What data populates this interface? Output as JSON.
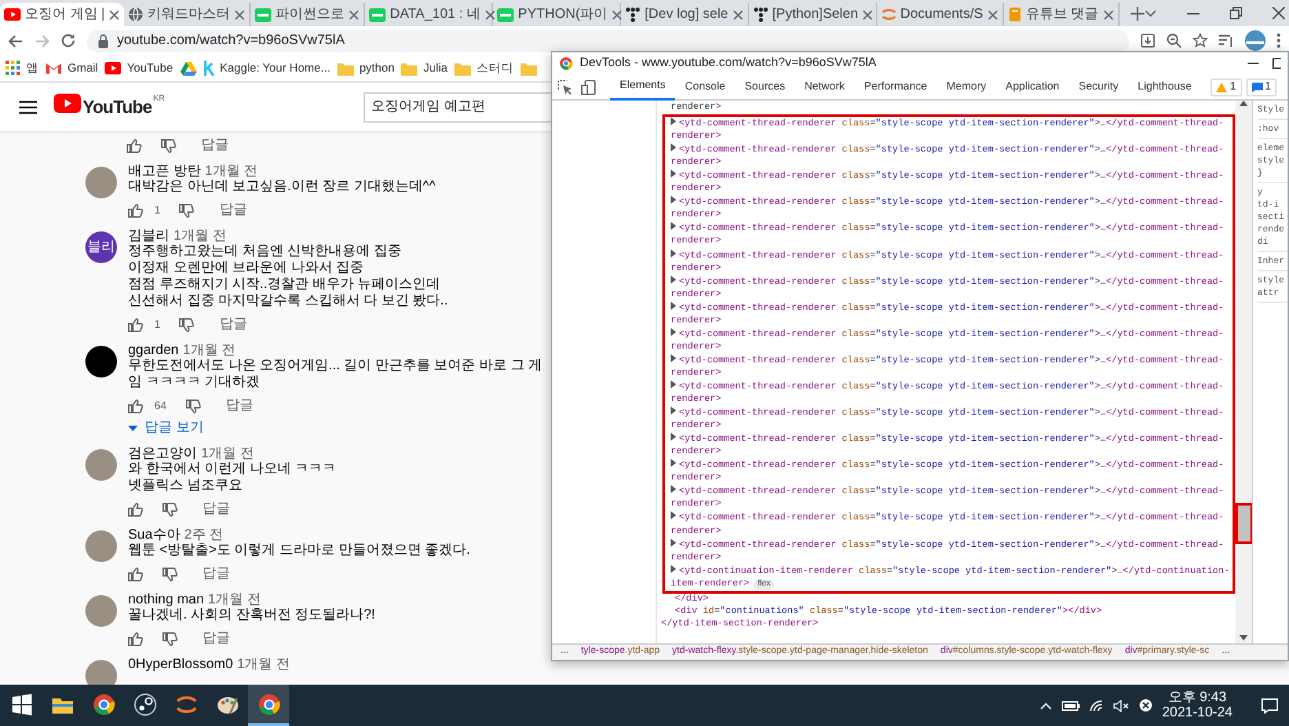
{
  "browser": {
    "tabs": [
      {
        "title": "오징어 게임 |",
        "selected": true
      },
      {
        "title": "키워드마스터",
        "selected": false
      },
      {
        "title": "파이썬으로",
        "selected": false
      },
      {
        "title": "DATA_101 : 네",
        "selected": false
      },
      {
        "title": "PYTHON(파이",
        "selected": false
      },
      {
        "title": "[Dev log] sele",
        "selected": false
      },
      {
        "title": "[Python]Selen",
        "selected": false
      },
      {
        "title": "Documents/S",
        "selected": false
      },
      {
        "title": "유튜브 댓글",
        "selected": false
      }
    ],
    "address": "youtube.com/watch?v=b96oSVw75lA",
    "bookmarks": [
      {
        "kind": "link",
        "label": "앱"
      },
      {
        "kind": "link",
        "label": "Gmail"
      },
      {
        "kind": "link",
        "label": "YouTube"
      },
      {
        "kind": "icon_only"
      },
      {
        "kind": "link",
        "label": "Kaggle: Your Home..."
      },
      {
        "kind": "link",
        "label": "python"
      },
      {
        "kind": "link",
        "label": "Julia"
      },
      {
        "kind": "link",
        "label": "스터디"
      },
      {
        "kind": "icon_only"
      }
    ]
  },
  "youtube": {
    "logo": "YouTube",
    "region": "KR",
    "search": {
      "value": "오징어게임 예고편"
    },
    "comments": [
      {
        "reply": "답글"
      },
      {
        "author": "배고픈 방탄",
        "time": "1개월 전",
        "avatar": {
          "kind": "photo"
        },
        "lines": [
          "대박감은 아닌데 보고싶음.이런 장르 기대했는데^^"
        ],
        "likes": "1",
        "reply": "답글"
      },
      {
        "author": "김블리",
        "time": "1개월 전",
        "avatar": {
          "kind": "initials",
          "text": "블리",
          "color": "#5e35b1"
        },
        "lines": [
          "정주행하고왔는데 처음엔 신박한내용에 집중",
          "이정재 오렌만에 브라운에 나와서 집중",
          "점점 루즈해지기 시작..경찰관 배우가 뉴페이스인데",
          "신선해서 집중 마지막갈수록 스킵해서 다 보긴 봤다.."
        ],
        "likes": "1",
        "reply": "답글"
      },
      {
        "author": "ggarden",
        "time": "1개월 전",
        "avatar": {
          "kind": "plain",
          "color": "#000000"
        },
        "lines": [
          "무한도전에서도 나온 오징어게임... 길이 만근추를 보여준 바로 그 게임 ㅋㅋㅋㅋ 기대하겠"
        ],
        "likes": "64",
        "reply": "답글",
        "view_replies": "답글 보기"
      },
      {
        "author": "검은고양이",
        "time": "1개월 전",
        "avatar": {
          "kind": "photo"
        },
        "lines": [
          "와 한국에서 이런게 나오네 ㅋㅋㅋ",
          "넷플릭스 넘조쿠요"
        ],
        "reply": "답글"
      },
      {
        "author": "Sua수아",
        "time": "2주 전",
        "avatar": {
          "kind": "photo"
        },
        "lines": [
          "웹툰 <방탈출>도 이렇게 드라마로 만들어졌으면 좋겠다."
        ],
        "reply": "답글"
      },
      {
        "author": "nothing man",
        "time": "1개월 전",
        "avatar": {
          "kind": "photo"
        },
        "lines": [
          "꿀나겠네. 사회의 잔혹버전 정도될라나?!"
        ],
        "reply": "답글"
      },
      {
        "author": "0HyperBlossom0",
        "time": "1개월 전",
        "avatar": {
          "kind": "photo"
        }
      }
    ]
  },
  "devtools": {
    "title": "DevTools - www.youtube.com/watch?v=b96oSVw75lA",
    "tabs": [
      {
        "label": "Elements",
        "selected": true
      },
      {
        "label": "Console",
        "selected": false
      },
      {
        "label": "Sources",
        "selected": false
      },
      {
        "label": "Network",
        "selected": false
      },
      {
        "label": "Performance",
        "selected": false
      },
      {
        "label": "Memory",
        "selected": false
      },
      {
        "label": "Application",
        "selected": false
      },
      {
        "label": "Security",
        "selected": false
      },
      {
        "label": "Lighthouse",
        "selected": false
      }
    ],
    "warnings": "1",
    "messages": "1",
    "nodes": [
      {
        "kind": "tail",
        "text": "renderer>"
      },
      {
        "kind": "highlight",
        "children": [
          {
            "kind": "collapsed",
            "text": "<ytd-comment-thread-renderer class=\"style-scope ytd-item-section-renderer\">…</ytd-comment-thread-renderer>"
          },
          {
            "kind": "collapsed",
            "text": "<ytd-comment-thread-renderer class=\"style-scope ytd-item-section-renderer\">…</ytd-comment-thread-renderer>"
          },
          {
            "kind": "collapsed",
            "text": "<ytd-comment-thread-renderer class=\"style-scope ytd-item-section-renderer\">…</ytd-comment-thread-renderer>"
          },
          {
            "kind": "collapsed",
            "text": "<ytd-comment-thread-renderer class=\"style-scope ytd-item-section-renderer\">…</ytd-comment-thread-renderer>"
          },
          {
            "kind": "collapsed",
            "text": "<ytd-comment-thread-renderer class=\"style-scope ytd-item-section-renderer\">…</ytd-comment-thread-renderer>"
          },
          {
            "kind": "collapsed",
            "text": "<ytd-comment-thread-renderer class=\"style-scope ytd-item-section-renderer\">…</ytd-comment-thread-renderer>"
          },
          {
            "kind": "collapsed",
            "text": "<ytd-comment-thread-renderer class=\"style-scope ytd-item-section-renderer\">…</ytd-comment-thread-renderer>"
          },
          {
            "kind": "collapsed",
            "text": "<ytd-comment-thread-renderer class=\"style-scope ytd-item-section-renderer\">…</ytd-comment-thread-renderer>"
          },
          {
            "kind": "collapsed",
            "text": "<ytd-comment-thread-renderer class=\"style-scope ytd-item-section-renderer\">…</ytd-comment-thread-renderer>"
          },
          {
            "kind": "collapsed",
            "text": "<ytd-comment-thread-renderer class=\"style-scope ytd-item-section-renderer\">…</ytd-comment-thread-renderer>"
          },
          {
            "kind": "collapsed",
            "text": "<ytd-comment-thread-renderer class=\"style-scope ytd-item-section-renderer\">…</ytd-comment-thread-renderer>"
          },
          {
            "kind": "collapsed",
            "text": "<ytd-comment-thread-renderer class=\"style-scope ytd-item-section-renderer\">…</ytd-comment-thread-renderer>"
          },
          {
            "kind": "collapsed",
            "text": "<ytd-comment-thread-renderer class=\"style-scope ytd-item-section-renderer\">…</ytd-comment-thread-renderer>"
          },
          {
            "kind": "collapsed",
            "text": "<ytd-comment-thread-renderer class=\"style-scope ytd-item-section-renderer\">…</ytd-comment-thread-renderer>"
          },
          {
            "kind": "collapsed",
            "text": "<ytd-comment-thread-renderer class=\"style-scope ytd-item-section-renderer\">…</ytd-comment-thread-renderer>"
          },
          {
            "kind": "collapsed",
            "text": "<ytd-comment-thread-renderer class=\"style-scope ytd-item-section-renderer\">…</ytd-comment-thread-renderer>"
          },
          {
            "kind": "collapsed",
            "text": "<ytd-comment-thread-renderer class=\"style-scope ytd-item-section-renderer\">…</ytd-comment-thread-renderer>"
          },
          {
            "kind": "collapsed",
            "text": "<ytd-continuation-item-renderer class=\"style-scope ytd-item-section-renderer\">…</ytd-continuation-item-renderer>",
            "badge": "flex"
          }
        ]
      },
      {
        "kind": "plain",
        "text": "</div>"
      },
      {
        "kind": "plain",
        "text": "<div id=\"continuations\" class=\"style-scope ytd-item-section-renderer\"></div>"
      },
      {
        "kind": "parent_close",
        "text": "</ytd-item-section-renderer>"
      }
    ],
    "scrollbar": {
      "highlighted": true
    },
    "styles": {
      "tab": "Style",
      "filter": ":hov",
      "blocks": [
        [
          "eleme",
          "style",
          "}"
        ],
        [
          "y",
          "td-i",
          "secti",
          "rende",
          "di"
        ]
      ],
      "section": "Inher",
      "inherited": [
        "style",
        "attr"
      ]
    },
    "breadcrumbs": [
      {
        "kind": "ellipsis",
        "text": "..."
      },
      {
        "kind": "crumb",
        "text": "tyle-scope.ytd-app"
      },
      {
        "kind": "crumb",
        "text": "ytd-watch-flexy.style-scope.ytd-page-manager.hide-skeleton"
      },
      {
        "kind": "crumb",
        "text": "div#columns.style-scope.ytd-watch-flexy"
      },
      {
        "kind": "crumb",
        "text": "div#primary.style-sc"
      },
      {
        "kind": "ellipsis",
        "text": "..."
      }
    ]
  },
  "taskbar": {
    "apps": [
      {
        "selected": false
      },
      {
        "selected": false
      },
      {
        "selected": false
      },
      {
        "selected": false
      },
      {
        "selected": false
      },
      {
        "selected": false
      },
      {
        "selected": true
      }
    ],
    "time": "오후 9:43",
    "date": "2021-10-24"
  }
}
